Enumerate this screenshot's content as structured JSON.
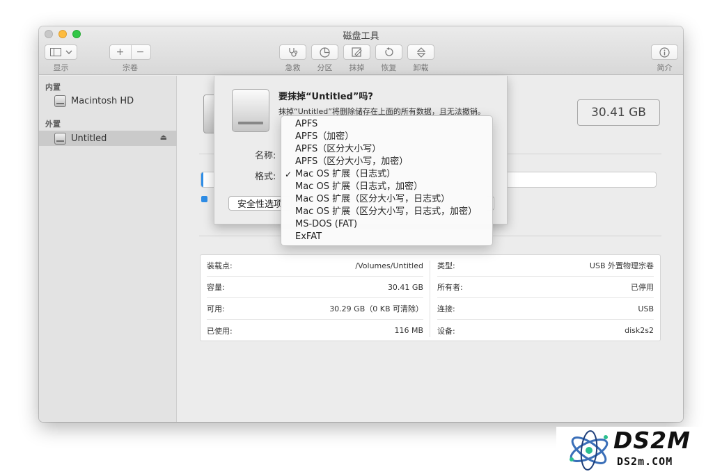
{
  "window": {
    "title": "磁盘工具"
  },
  "toolbar": {
    "view_label": "显示",
    "volume_label": "宗卷",
    "add_symbol": "+",
    "remove_symbol": "−",
    "rescue_label": "急救",
    "partition_label": "分区",
    "erase_label": "抹掉",
    "restore_label": "恢复",
    "unmount_label": "卸载",
    "info_label": "简介"
  },
  "sidebar": {
    "internal_header": "内置",
    "external_header": "外置",
    "items": [
      {
        "label": "Macintosh HD",
        "selected": false,
        "icon": "internal-disk-icon"
      },
      {
        "label": "Untitled",
        "selected": true,
        "icon": "external-disk-icon",
        "eject": "⏏"
      }
    ]
  },
  "main": {
    "capacity_display": "30.41 GB",
    "usage": {
      "used_fraction": 0.004,
      "color": "#2e8de6"
    },
    "info_left": [
      {
        "key": "装载点:",
        "value": "/Volumes/Untitled"
      },
      {
        "key": "容量:",
        "value": "30.41 GB"
      },
      {
        "key": "可用:",
        "value": "30.29 GB（0 KB 可清除）"
      },
      {
        "key": "已使用:",
        "value": "116 MB"
      }
    ],
    "info_right": [
      {
        "key": "类型:",
        "value": "USB 外置物理宗卷"
      },
      {
        "key": "所有者:",
        "value": "已停用"
      },
      {
        "key": "连接:",
        "value": "USB"
      },
      {
        "key": "设备:",
        "value": "disk2s2"
      }
    ]
  },
  "sheet": {
    "title": "要抹掉“Untitled”吗?",
    "description": "抹掉“Untitled”将删除储存在上面的所有数据，且无法撤销。",
    "name_label": "名称:",
    "format_label": "格式:",
    "security_button": "安全性选项"
  },
  "format_menu": {
    "selected_index": 4,
    "check_mark": "✓",
    "options": [
      "APFS",
      "APFS（加密）",
      "APFS（区分大小写）",
      "APFS（区分大小写，加密）",
      "Mac OS 扩展（日志式）",
      "Mac OS 扩展（日志式，加密）",
      "Mac OS 扩展（区分大小写，日志式）",
      "Mac OS 扩展（区分大小写，日志式，加密）",
      "MS-DOS (FAT)",
      "ExFAT"
    ]
  },
  "watermark": {
    "brand": "DS2M",
    "domain": "DS2m.COM"
  }
}
